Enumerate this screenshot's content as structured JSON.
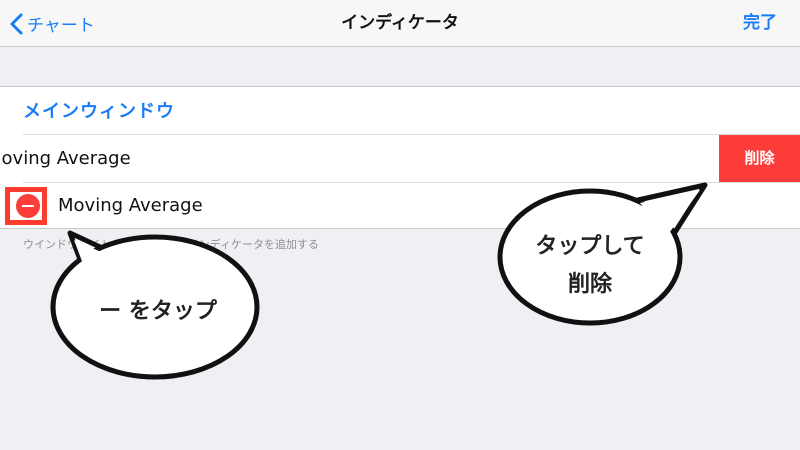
{
  "nav": {
    "back_label": "チャート",
    "title": "インディケータ",
    "done_label": "完了"
  },
  "section": {
    "header": "メインウィンドウ",
    "rows": [
      {
        "label": "Moving Average",
        "action_label": "削除"
      },
      {
        "label": "Moving Average"
      }
    ],
    "footer": "ウインドウタイトルをタップしてインディケータを追加する"
  },
  "callouts": {
    "left": "ー をタップ",
    "right_line1": "タップして",
    "right_line2": "削除"
  },
  "colors": {
    "accent": "#1a7cf6",
    "destructive": "#fc3d39",
    "background": "#efeff4"
  },
  "icons": {
    "back": "chevron-left-icon",
    "remove": "minus-circle-icon"
  }
}
